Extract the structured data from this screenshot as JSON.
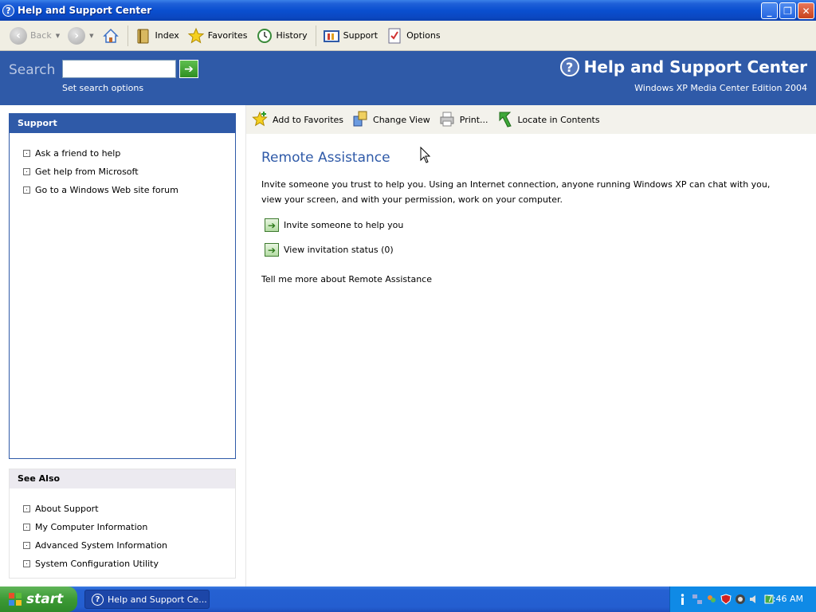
{
  "window": {
    "title": "Help and Support Center",
    "buttons": {
      "minimize": "_",
      "maximize": "❐",
      "close": "✕"
    }
  },
  "toolbar": {
    "back_label": "Back",
    "index_label": "Index",
    "favorites_label": "Favorites",
    "history_label": "History",
    "support_label": "Support",
    "options_label": "Options"
  },
  "header": {
    "search_label": "Search",
    "search_value": "",
    "search_options": "Set search options",
    "app_title": "Help and Support Center",
    "edition": "Windows XP Media Center Edition 2004"
  },
  "support_panel": {
    "title": "Support",
    "items": [
      {
        "label": "Ask a friend to help"
      },
      {
        "label": "Get help from Microsoft"
      },
      {
        "label": "Go to a Windows Web site forum"
      }
    ]
  },
  "see_also_panel": {
    "title": "See Also",
    "items": [
      {
        "label": "About Support"
      },
      {
        "label": "My Computer Information"
      },
      {
        "label": "Advanced System Information"
      },
      {
        "label": "System Configuration Utility"
      }
    ]
  },
  "content_toolbar": {
    "add_favorites": "Add to Favorites",
    "change_view": "Change View",
    "print": "Print...",
    "locate": "Locate in Contents"
  },
  "content": {
    "heading": "Remote Assistance",
    "description": "Invite someone you trust to help you. Using an Internet connection, anyone running Windows XP can chat with you, view your screen, and with your permission, work on your computer.",
    "tasks": [
      {
        "label": "Invite someone to help you"
      },
      {
        "label": "View invitation status (0)"
      }
    ],
    "tell_more": "Tell me more about Remote Assistance"
  },
  "taskbar": {
    "start_label": "start",
    "window_button": "Help and Support Ce...",
    "clock": "7:46 AM"
  },
  "colors": {
    "title_bar": "#0a4fd0",
    "header_band": "#2f5aa8",
    "heading": "#2f5aa8",
    "toolbar_bg": "#f0eee3"
  }
}
